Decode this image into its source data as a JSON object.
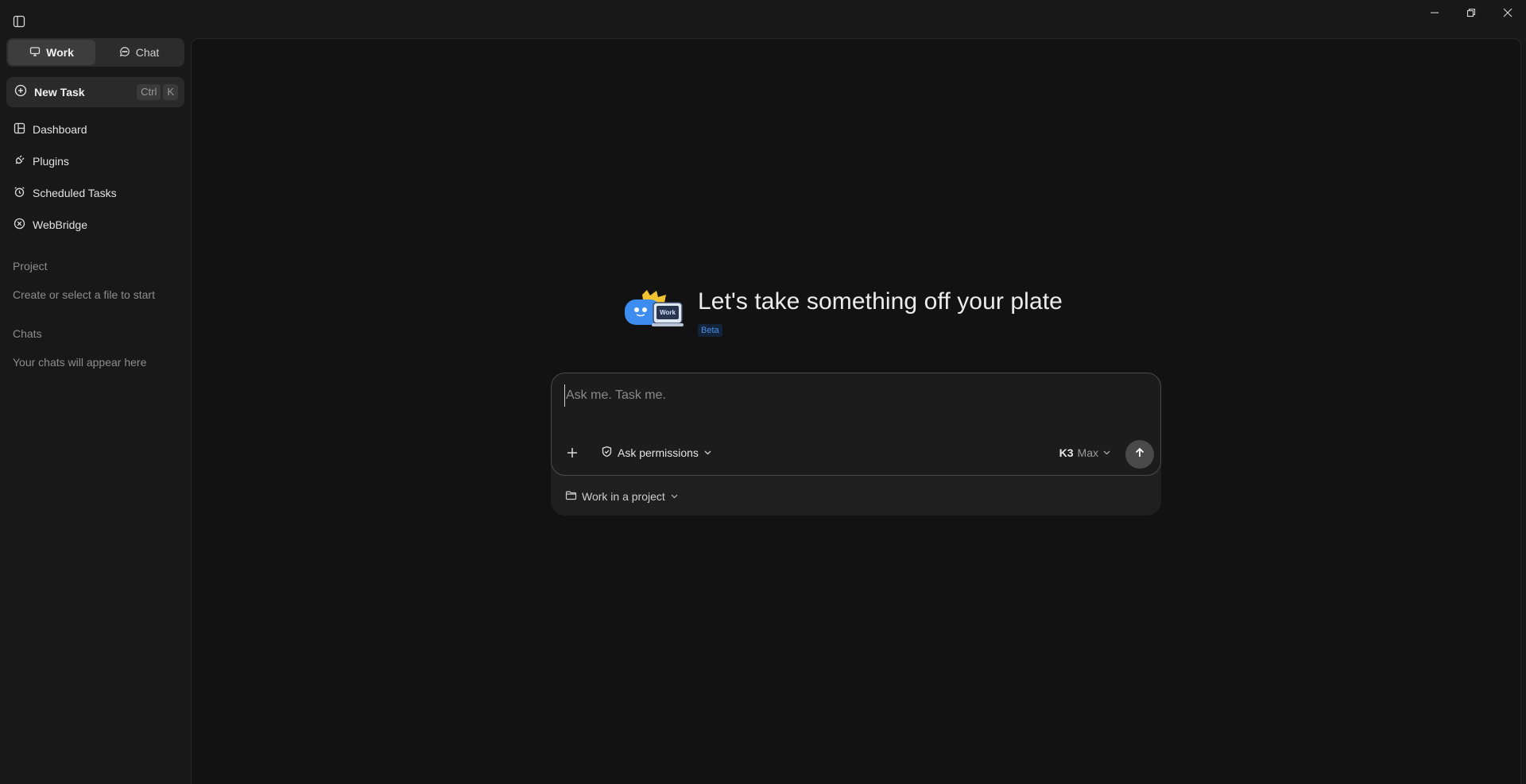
{
  "titlebar": {
    "sidebar_toggle_icon": "sidebar-panel-icon",
    "controls": [
      "minimize-icon",
      "restore-icon",
      "close-icon"
    ]
  },
  "sidebar": {
    "modes": [
      {
        "label": "Work",
        "icon": "monitor-icon",
        "active": true
      },
      {
        "label": "Chat",
        "icon": "chat-bubble-icon",
        "active": false
      }
    ],
    "new_task": {
      "label": "New Task",
      "icon": "plus-circle-icon",
      "shortcut": [
        "Ctrl",
        "K"
      ]
    },
    "items": [
      {
        "label": "Dashboard",
        "icon": "dashboard-icon"
      },
      {
        "label": "Plugins",
        "icon": "plug-icon"
      },
      {
        "label": "Scheduled Tasks",
        "icon": "alarm-clock-icon"
      },
      {
        "label": "WebBridge",
        "icon": "webbridge-icon"
      }
    ],
    "project": {
      "heading": "Project",
      "hint": "Create or select a file to start"
    },
    "chats": {
      "heading": "Chats",
      "hint": "Your chats will appear here"
    }
  },
  "main": {
    "hero": {
      "title": "Let's take something off your plate",
      "badge": "Beta",
      "mascot_text": "Work"
    },
    "composer": {
      "placeholder": "Ask me. Task me.",
      "value": "",
      "permissions_label": "Ask permissions",
      "model_name": "K3",
      "model_variant": "Max",
      "project_label": "Work in a project"
    }
  },
  "colors": {
    "background": "#181818",
    "panel": "#121212",
    "accent_blue": "#4a8fe6",
    "send_button": "#4a4a4a"
  }
}
